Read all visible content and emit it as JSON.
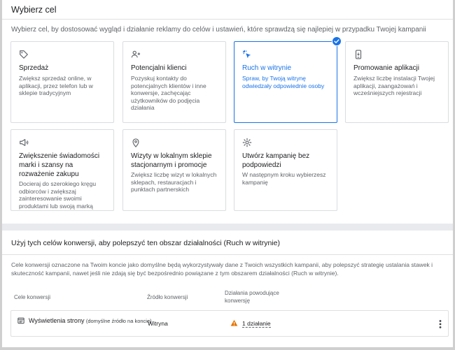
{
  "goal_panel": {
    "title": "Wybierz cel",
    "intro": "Wybierz cel, by dostosować wygląd i działanie reklamy do celów i ustawień, które sprawdzą się najlepiej w przypadku Twojej kampanii",
    "cards": [
      {
        "icon": "tag-icon",
        "title": "Sprzedaż",
        "desc": "Zwiększ sprzedaż online, w aplikacji, przez telefon lub w sklepie tradycyjnym",
        "selected": false
      },
      {
        "icon": "people-icon",
        "title": "Potencjalni klienci",
        "desc": "Pozyskuj kontakty do potencjalnych klientów i inne konwersje, zachęcając użytkowników do podjęcia działania",
        "selected": false
      },
      {
        "icon": "cursor-click-icon",
        "title": "Ruch w witrynie",
        "desc": "Spraw, by Twoją witrynę odwiedzały odpowiednie osoby",
        "selected": true
      },
      {
        "icon": "phone-icon",
        "title": "Promowanie aplikacji",
        "desc": "Zwiększ liczbę instalacji Twojej aplikacji, zaangażowań i wcześniejszych rejestracji",
        "selected": false
      },
      {
        "icon": "megaphone-icon",
        "title": "Zwiększenie świadomości marki i szansy na rozważenie zakupu",
        "desc": "Docieraj do szerokiego kręgu odbiorców i zwiększaj zainteresowanie swoimi produktami lub swoją marką",
        "selected": false
      },
      {
        "icon": "map-pin-icon",
        "title": "Wizyty w lokalnym sklepie stacjonarnym i promocje",
        "desc": "Zwiększ liczbę wizyt w lokalnych sklepach, restauracjach i punktach partnerskich",
        "selected": false
      },
      {
        "icon": "gear-icon",
        "title": "Utwórz kampanię bez podpowiedzi",
        "desc": "W następnym kroku wybierzesz kampanię",
        "selected": false
      }
    ]
  },
  "conversion_panel": {
    "title": "Użyj tych celów konwersji, aby polepszyć ten obszar działalności (Ruch w witrynie)",
    "desc": "Cele konwersji oznaczone na Twoim koncie jako domyślne będą wykorzystywały dane z Twoich wszystkich kampanii, aby polepszyć strategię ustalania stawek i skuteczność kampanii, nawet jeśli nie zdają się być bezpośrednio powiązane z tym obszarem działalności (Ruch w witrynie).",
    "columns": {
      "goal": "Cele konwersji",
      "source": "Źródło konwersji",
      "actions": "Działania powodujące konwersję"
    },
    "rows": [
      {
        "name": "Wyświetlenia strony",
        "sub": "(domyślne źródło na koncie)",
        "source": "Witryna",
        "actions": "1 działanie"
      }
    ]
  }
}
